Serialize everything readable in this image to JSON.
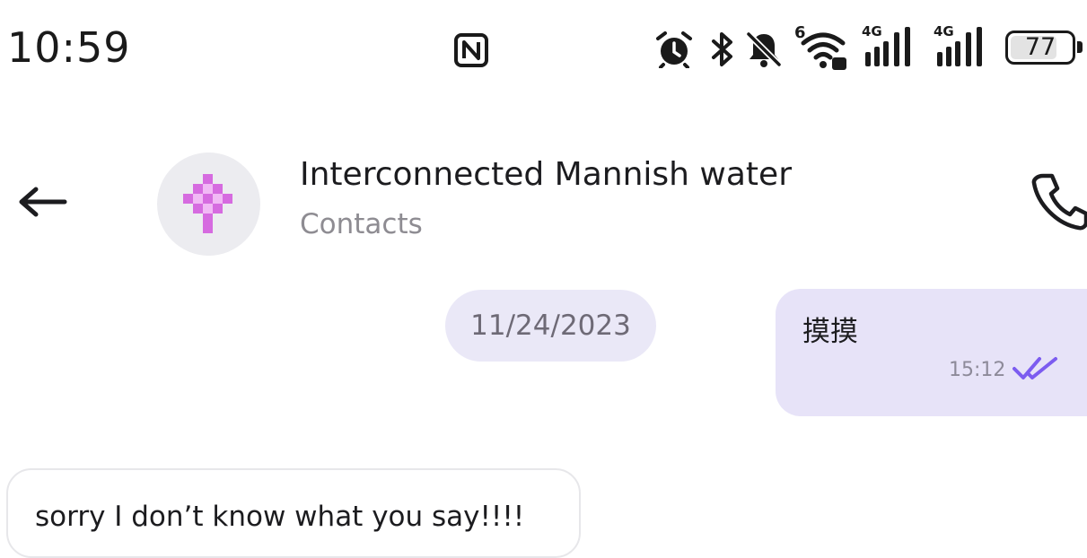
{
  "status_bar": {
    "time": "10:59",
    "network_1": "4G",
    "network_2": "4G",
    "wifi_badge": "6",
    "battery_level": 77,
    "battery_text": "77",
    "icons": [
      "nfc-icon",
      "alarm-icon",
      "bluetooth-icon",
      "mute-icon",
      "wifi-icon",
      "signal-icon",
      "signal-icon",
      "battery-icon"
    ]
  },
  "header": {
    "contact_name": "Interconnected Mannish water",
    "contact_subtitle": "Contacts",
    "icons": [
      "back-arrow-icon",
      "avatar",
      "phone-icon"
    ]
  },
  "chat": {
    "date_separator": "11/24/2023",
    "messages": [
      {
        "direction": "outgoing",
        "text": "摸摸",
        "time": "15:12",
        "status": "read"
      },
      {
        "direction": "incoming",
        "text": "sorry I don’t know what you say!!!!"
      }
    ]
  },
  "colors": {
    "accent": "#7c5cf0",
    "outgoing_bubble": "#e7e3f8",
    "date_pill": "#eae8f7",
    "avatar_pixel": "#d66be0"
  }
}
